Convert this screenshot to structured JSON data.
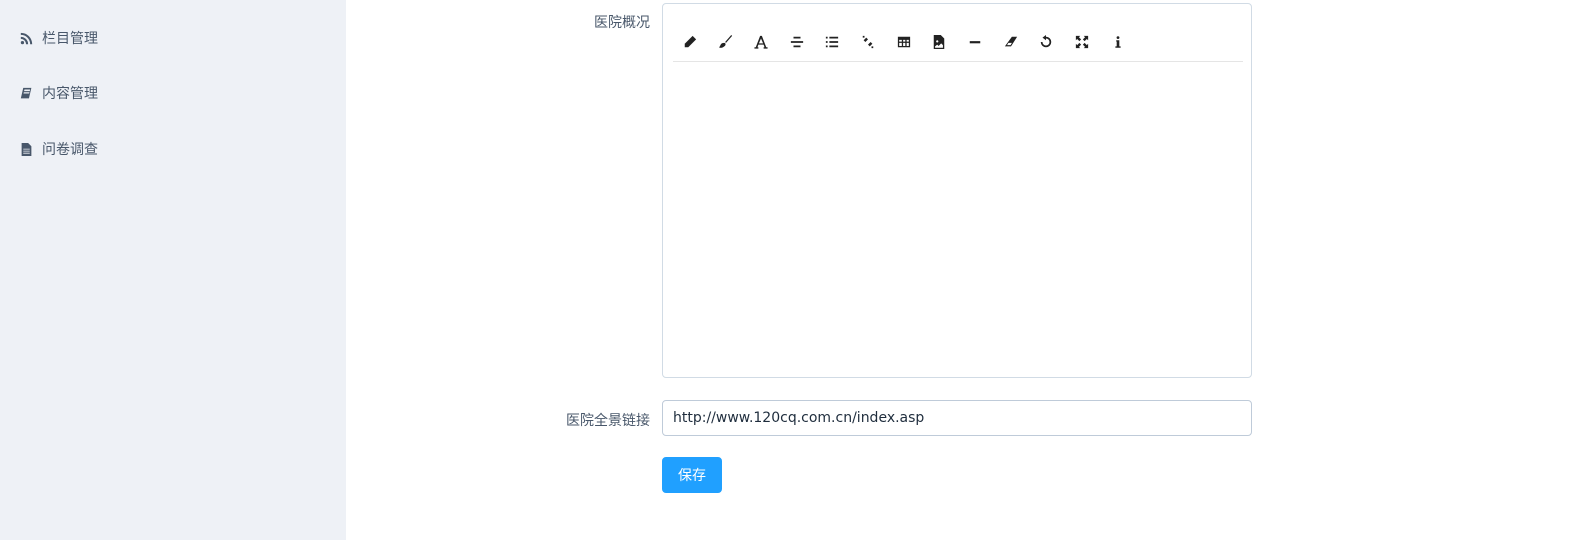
{
  "sidebar": {
    "items": [
      {
        "label": "栏目管理",
        "icon": "rss-icon"
      },
      {
        "label": "内容管理",
        "icon": "book-icon"
      },
      {
        "label": "问卷调查",
        "icon": "file-text-icon"
      }
    ]
  },
  "form": {
    "overview_label": "医院概况",
    "overview_content": "",
    "panorama_label": "医院全景链接",
    "panorama_value": "http://www.120cq.com.cn/index.asp",
    "save_label": "保存"
  },
  "toolbar": {
    "buttons": [
      "pencil-icon",
      "paint-brush-icon",
      "font-icon",
      "align-center-icon",
      "list-icon",
      "unlink-icon",
      "table-icon",
      "image-icon",
      "horizontal-rule-icon",
      "eraser-icon",
      "undo-icon",
      "fullscreen-icon",
      "info-icon"
    ]
  },
  "colors": {
    "sidebar_bg": "#eef1f6",
    "primary": "#20a0ff",
    "text": "#48576a"
  }
}
